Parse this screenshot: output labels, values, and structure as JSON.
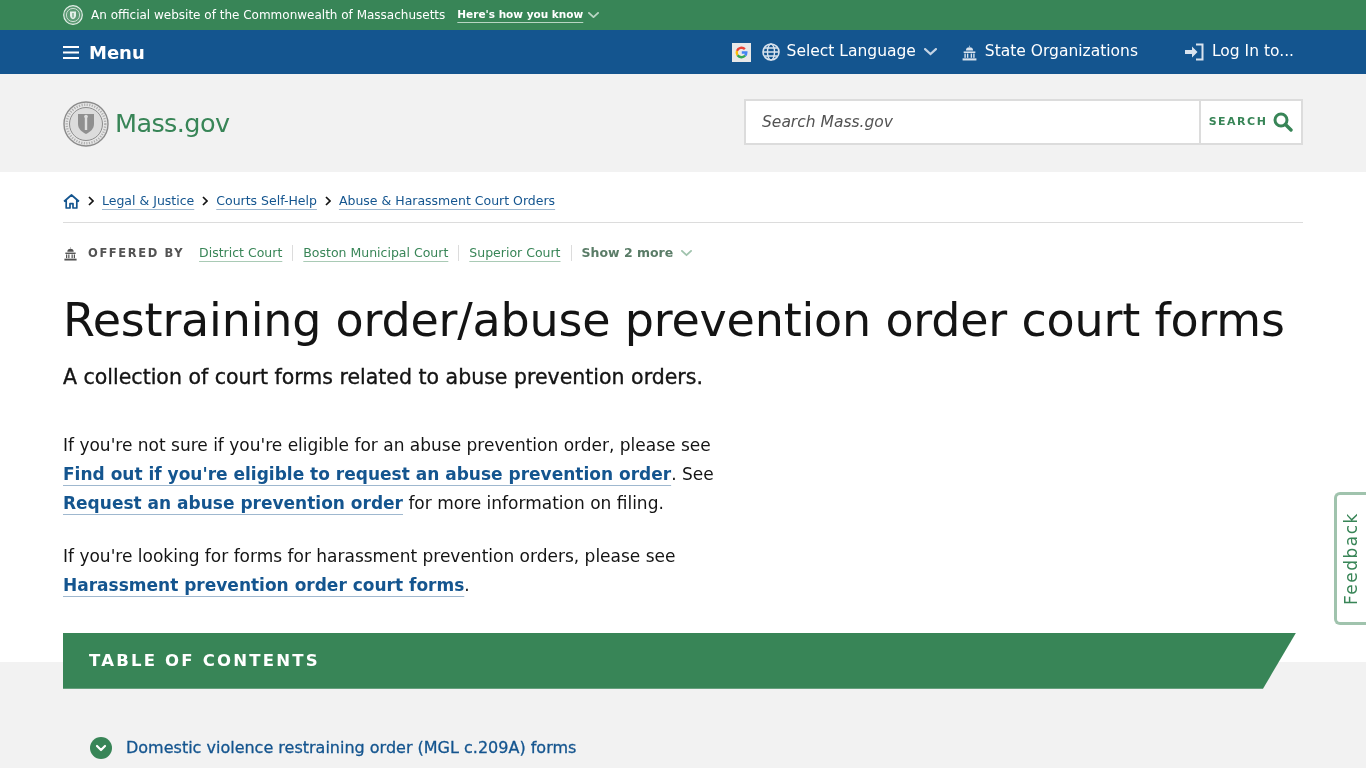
{
  "official_banner": {
    "text": "An official website of the Commonwealth of Massachusetts",
    "link": "Here's how you know"
  },
  "nav_bar": {
    "menu": "Menu",
    "items": [
      {
        "kind": "language",
        "label": "Select Language"
      },
      {
        "kind": "organizations",
        "label": "State Organizations"
      },
      {
        "kind": "login",
        "label": "Log In to..."
      }
    ]
  },
  "header": {
    "logo_text": "Mass.gov",
    "search": {
      "placeholder": "Search Mass.gov",
      "button": "SEARCH"
    }
  },
  "breadcrumbs": [
    "Legal & Justice",
    "Courts Self-Help",
    "Abuse & Harassment Court Orders"
  ],
  "offered_by": {
    "label": "OFFERED BY",
    "organizations": [
      "District Court",
      "Boston Municipal Court",
      "Superior Court"
    ],
    "more": "Show 2 more"
  },
  "title": "Restraining order/abuse prevention order court forms",
  "subtitle": "A collection of court forms related to abuse prevention orders.",
  "paragraphs": [
    {
      "segments": [
        {
          "kind": "text",
          "text": "If you're not sure if you're eligible for an abuse prevention order, please see "
        },
        {
          "kind": "link",
          "text": "Find out if you're eligible to request an abuse prevention order"
        },
        {
          "kind": "text",
          "text": ". See "
        },
        {
          "kind": "link",
          "text": "Request an abuse prevention order"
        },
        {
          "kind": "text",
          "text": " for more information on filing."
        }
      ]
    },
    {
      "segments": [
        {
          "kind": "text",
          "text": "If you're looking for forms for harassment prevention orders, please see "
        },
        {
          "kind": "link",
          "text": "Harassment prevention order court forms"
        },
        {
          "kind": "text",
          "text": "."
        }
      ]
    }
  ],
  "table_of_contents": {
    "title": "TABLE OF CONTENTS",
    "items": [
      {
        "label": "Domestic violence restraining order (MGL c.209A) forms",
        "expanded": false
      }
    ]
  },
  "feedback": "Feedback"
}
